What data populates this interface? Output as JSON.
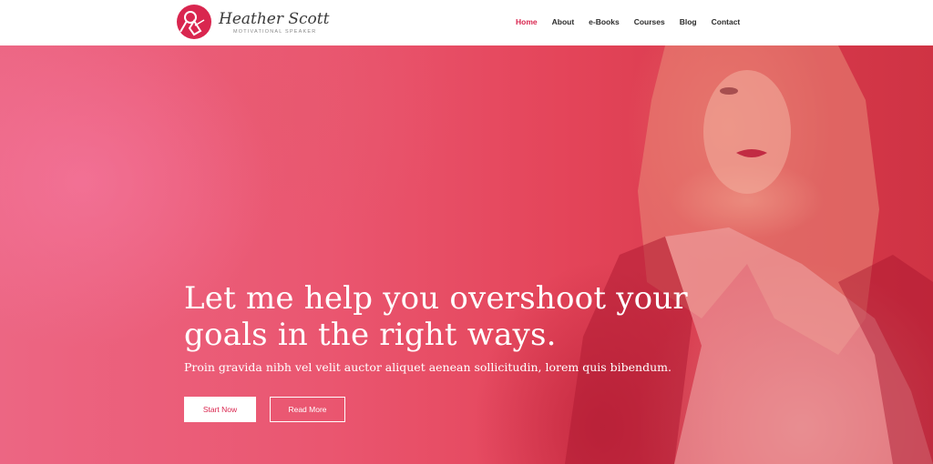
{
  "brand": {
    "name": "Heather Scott",
    "tagline": "MOTIVATIONAL SPEAKER",
    "logo_icon": "microphone-icon",
    "accent_color": "#d9264f"
  },
  "nav": {
    "items": [
      {
        "label": "Home",
        "active": true
      },
      {
        "label": "About",
        "active": false
      },
      {
        "label": "e-Books",
        "active": false
      },
      {
        "label": "Courses",
        "active": false
      },
      {
        "label": "Blog",
        "active": false
      },
      {
        "label": "Contact",
        "active": false
      }
    ]
  },
  "hero": {
    "title_line1": "Let me help you overshoot your",
    "title_line2": "goals in the right ways.",
    "subtitle": "Proin gravida nibh vel velit auctor aliquet aenean sollicitudin, lorem quis bibendum.",
    "primary_button": "Start Now",
    "secondary_button": "Read More",
    "overlay_color": "#e8475f"
  }
}
